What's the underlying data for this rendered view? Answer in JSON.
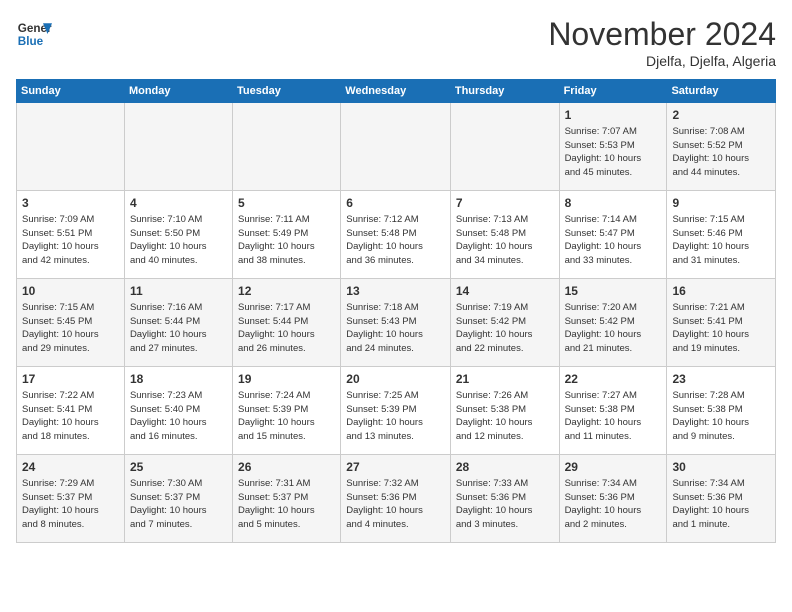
{
  "header": {
    "logo_line1": "General",
    "logo_line2": "Blue",
    "month": "November 2024",
    "location": "Djelfa, Djelfa, Algeria"
  },
  "weekdays": [
    "Sunday",
    "Monday",
    "Tuesday",
    "Wednesday",
    "Thursday",
    "Friday",
    "Saturday"
  ],
  "weeks": [
    [
      {
        "day": "",
        "info": ""
      },
      {
        "day": "",
        "info": ""
      },
      {
        "day": "",
        "info": ""
      },
      {
        "day": "",
        "info": ""
      },
      {
        "day": "",
        "info": ""
      },
      {
        "day": "1",
        "info": "Sunrise: 7:07 AM\nSunset: 5:53 PM\nDaylight: 10 hours\nand 45 minutes."
      },
      {
        "day": "2",
        "info": "Sunrise: 7:08 AM\nSunset: 5:52 PM\nDaylight: 10 hours\nand 44 minutes."
      }
    ],
    [
      {
        "day": "3",
        "info": "Sunrise: 7:09 AM\nSunset: 5:51 PM\nDaylight: 10 hours\nand 42 minutes."
      },
      {
        "day": "4",
        "info": "Sunrise: 7:10 AM\nSunset: 5:50 PM\nDaylight: 10 hours\nand 40 minutes."
      },
      {
        "day": "5",
        "info": "Sunrise: 7:11 AM\nSunset: 5:49 PM\nDaylight: 10 hours\nand 38 minutes."
      },
      {
        "day": "6",
        "info": "Sunrise: 7:12 AM\nSunset: 5:48 PM\nDaylight: 10 hours\nand 36 minutes."
      },
      {
        "day": "7",
        "info": "Sunrise: 7:13 AM\nSunset: 5:48 PM\nDaylight: 10 hours\nand 34 minutes."
      },
      {
        "day": "8",
        "info": "Sunrise: 7:14 AM\nSunset: 5:47 PM\nDaylight: 10 hours\nand 33 minutes."
      },
      {
        "day": "9",
        "info": "Sunrise: 7:15 AM\nSunset: 5:46 PM\nDaylight: 10 hours\nand 31 minutes."
      }
    ],
    [
      {
        "day": "10",
        "info": "Sunrise: 7:15 AM\nSunset: 5:45 PM\nDaylight: 10 hours\nand 29 minutes."
      },
      {
        "day": "11",
        "info": "Sunrise: 7:16 AM\nSunset: 5:44 PM\nDaylight: 10 hours\nand 27 minutes."
      },
      {
        "day": "12",
        "info": "Sunrise: 7:17 AM\nSunset: 5:44 PM\nDaylight: 10 hours\nand 26 minutes."
      },
      {
        "day": "13",
        "info": "Sunrise: 7:18 AM\nSunset: 5:43 PM\nDaylight: 10 hours\nand 24 minutes."
      },
      {
        "day": "14",
        "info": "Sunrise: 7:19 AM\nSunset: 5:42 PM\nDaylight: 10 hours\nand 22 minutes."
      },
      {
        "day": "15",
        "info": "Sunrise: 7:20 AM\nSunset: 5:42 PM\nDaylight: 10 hours\nand 21 minutes."
      },
      {
        "day": "16",
        "info": "Sunrise: 7:21 AM\nSunset: 5:41 PM\nDaylight: 10 hours\nand 19 minutes."
      }
    ],
    [
      {
        "day": "17",
        "info": "Sunrise: 7:22 AM\nSunset: 5:41 PM\nDaylight: 10 hours\nand 18 minutes."
      },
      {
        "day": "18",
        "info": "Sunrise: 7:23 AM\nSunset: 5:40 PM\nDaylight: 10 hours\nand 16 minutes."
      },
      {
        "day": "19",
        "info": "Sunrise: 7:24 AM\nSunset: 5:39 PM\nDaylight: 10 hours\nand 15 minutes."
      },
      {
        "day": "20",
        "info": "Sunrise: 7:25 AM\nSunset: 5:39 PM\nDaylight: 10 hours\nand 13 minutes."
      },
      {
        "day": "21",
        "info": "Sunrise: 7:26 AM\nSunset: 5:38 PM\nDaylight: 10 hours\nand 12 minutes."
      },
      {
        "day": "22",
        "info": "Sunrise: 7:27 AM\nSunset: 5:38 PM\nDaylight: 10 hours\nand 11 minutes."
      },
      {
        "day": "23",
        "info": "Sunrise: 7:28 AM\nSunset: 5:38 PM\nDaylight: 10 hours\nand 9 minutes."
      }
    ],
    [
      {
        "day": "24",
        "info": "Sunrise: 7:29 AM\nSunset: 5:37 PM\nDaylight: 10 hours\nand 8 minutes."
      },
      {
        "day": "25",
        "info": "Sunrise: 7:30 AM\nSunset: 5:37 PM\nDaylight: 10 hours\nand 7 minutes."
      },
      {
        "day": "26",
        "info": "Sunrise: 7:31 AM\nSunset: 5:37 PM\nDaylight: 10 hours\nand 5 minutes."
      },
      {
        "day": "27",
        "info": "Sunrise: 7:32 AM\nSunset: 5:36 PM\nDaylight: 10 hours\nand 4 minutes."
      },
      {
        "day": "28",
        "info": "Sunrise: 7:33 AM\nSunset: 5:36 PM\nDaylight: 10 hours\nand 3 minutes."
      },
      {
        "day": "29",
        "info": "Sunrise: 7:34 AM\nSunset: 5:36 PM\nDaylight: 10 hours\nand 2 minutes."
      },
      {
        "day": "30",
        "info": "Sunrise: 7:34 AM\nSunset: 5:36 PM\nDaylight: 10 hours\nand 1 minute."
      }
    ]
  ]
}
